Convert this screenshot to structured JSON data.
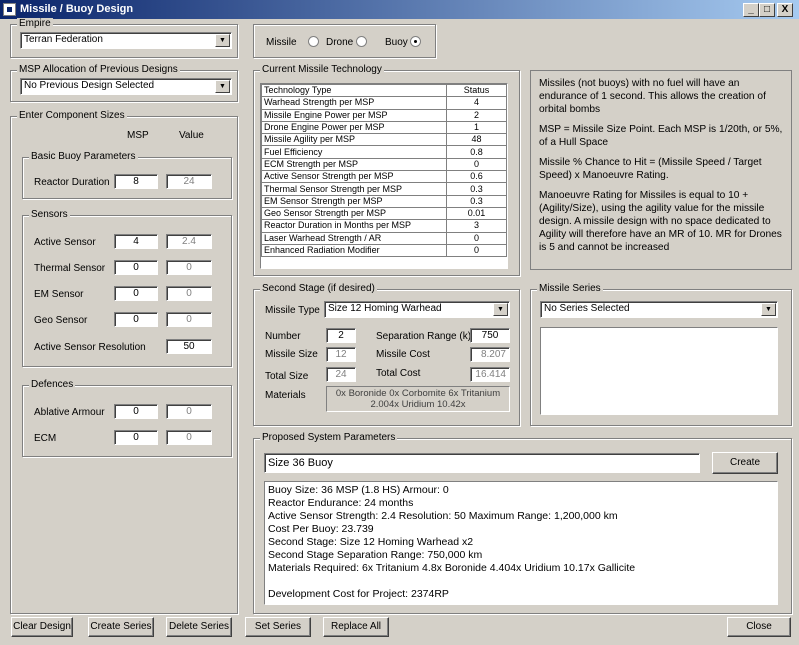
{
  "window": {
    "title": "Missile / Buoy Design",
    "min_label": "_",
    "max_label": "□",
    "close_label": "X"
  },
  "empire": {
    "group_label": "Empire",
    "selected": "Terran Federation"
  },
  "type_select": {
    "missile_label": "Missile",
    "drone_label": "Drone",
    "buoy_label": "Buoy",
    "selected": "Buoy"
  },
  "msp_allocation": {
    "group_label": "MSP Allocation of Previous Designs",
    "selected": "No Previous Design Selected"
  },
  "components": {
    "group_label": "Enter Component Sizes",
    "col_msp": "MSP",
    "col_value": "Value",
    "basic": {
      "group_label": "Basic Buoy Parameters",
      "reactor_label": "Reactor Duration",
      "reactor_msp": "8",
      "reactor_value": "24"
    },
    "sensors": {
      "group_label": "Sensors",
      "rows": [
        {
          "label": "Active Sensor",
          "msp": "4",
          "value": "2.4"
        },
        {
          "label": "Thermal Sensor",
          "msp": "0",
          "value": "0"
        },
        {
          "label": "EM Sensor",
          "msp": "0",
          "value": "0"
        },
        {
          "label": "Geo Sensor",
          "msp": "0",
          "value": "0"
        }
      ],
      "resolution_label": "Active Sensor Resolution",
      "resolution_value": "50"
    },
    "defences": {
      "group_label": "Defences",
      "rows": [
        {
          "label": "Ablative Armour",
          "msp": "0",
          "value": "0"
        },
        {
          "label": "ECM",
          "msp": "0",
          "value": "0"
        }
      ]
    }
  },
  "tech": {
    "group_label": "Current Missile Technology",
    "col_type": "Technology Type",
    "col_status": "Status",
    "rows": [
      {
        "type": "Warhead Strength per MSP",
        "status": "4"
      },
      {
        "type": "Missile Engine Power per MSP",
        "status": "2"
      },
      {
        "type": "Drone Engine Power per MSP",
        "status": "1"
      },
      {
        "type": "Missile Agility per MSP",
        "status": "48"
      },
      {
        "type": "Fuel Efficiency",
        "status": "0.8"
      },
      {
        "type": "ECM Strength per MSP",
        "status": "0"
      },
      {
        "type": "Active Sensor Strength per MSP",
        "status": "0.6"
      },
      {
        "type": "Thermal Sensor Strength per MSP",
        "status": "0.3"
      },
      {
        "type": "EM Sensor Strength per MSP",
        "status": "0.3"
      },
      {
        "type": "Geo Sensor Strength per MSP",
        "status": "0.01"
      },
      {
        "type": "Reactor Duration in Months per MSP",
        "status": "3"
      },
      {
        "type": "Laser Warhead Strength / AR",
        "status": "0"
      },
      {
        "type": "Enhanced Radiation Modifier",
        "status": "0"
      }
    ]
  },
  "info": {
    "p1": "Missiles (not buoys) with no fuel will have an endurance of 1 second. This allows the creation of orbital bombs",
    "p2": "MSP = Missile Size Point. Each MSP is 1/20th, or 5%, of a Hull Space",
    "p3": "Missile % Chance to Hit = (Missile Speed / Target Speed) x Manoeuvre Rating.",
    "p4": "Manoeuvre Rating for Missiles is equal to 10 + (Agility/Size), using the agility value for the missile design. A missile design with no space dedicated to Agility will therefore have an MR of 10. MR for Drones is 5 and cannot be increased"
  },
  "second_stage": {
    "group_label": "Second Stage (if desired)",
    "missile_type_label": "Missile Type",
    "missile_type_value": "Size 12 Homing Warhead",
    "number_label": "Number",
    "number_value": "2",
    "sep_range_label": "Separation Range (k)",
    "sep_range_value": "750",
    "missile_size_label": "Missile Size",
    "missile_size_value": "12",
    "missile_cost_label": "Missile Cost",
    "missile_cost_value": "8.207",
    "total_size_label": "Total Size",
    "total_size_value": "24",
    "total_cost_label": "Total Cost",
    "total_cost_value": "16.414",
    "materials_label": "Materials",
    "materials_value": "0x Boronide  0x Corbomite  6x Tritanium  2.004x Uridium  10.42x"
  },
  "series": {
    "group_label": "Missile Series",
    "selected": "No Series Selected"
  },
  "proposed": {
    "group_label": "Proposed System Parameters",
    "name_value": "Size 36 Buoy",
    "create_label": "Create",
    "lines": [
      "Buoy Size: 36 MSP  (1.8 HS)    Armour: 0",
      "Reactor Endurance: 24 months",
      "Active Sensor Strength: 2.4    Resolution: 50    Maximum Range: 1,200,000 km",
      "Cost Per Buoy: 23.739",
      "Second Stage: Size 12 Homing Warhead x2",
      "Second Stage Separation Range: 750,000 km",
      "Materials Required:    6x Tritanium    4.8x Boronide    4.404x Uridium    10.17x Gallicite",
      "",
      "Development Cost for Project: 2374RP"
    ]
  },
  "buttons": {
    "clear": "Clear Design",
    "create_series": "Create Series",
    "delete_series": "Delete Series",
    "set_series": "Set Series",
    "replace_all": "Replace All",
    "close": "Close"
  }
}
